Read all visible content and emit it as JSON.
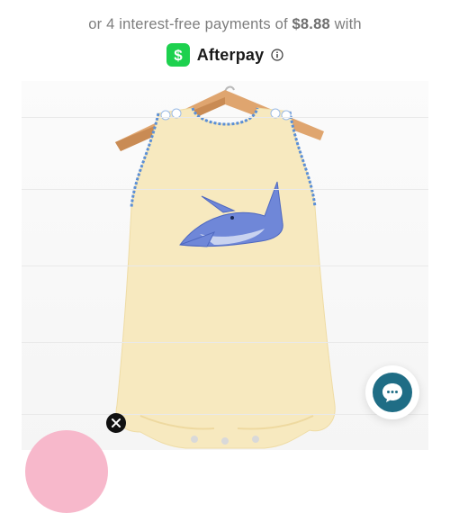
{
  "installments": {
    "prefix": "or 4 interest-free payments of",
    "amount": "$8.88",
    "suffix": "with"
  },
  "afterpay": {
    "label": "Afterpay",
    "logo_icon": "cash-app-dollar-icon",
    "info_icon": "info-icon",
    "brand_color": "#1dd14e"
  },
  "product_image": {
    "subject": "yellow sleeveless romper with blue shark applique on wooden hanger"
  },
  "overlay": {
    "close_icon": "close-icon",
    "chat_icon": "chat-bubble-icon",
    "chat_color": "#1f6d85",
    "pink_badge_color": "#f7b8cb"
  }
}
